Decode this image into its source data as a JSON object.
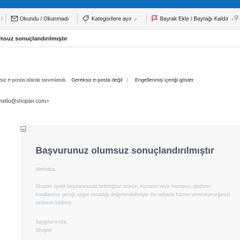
{
  "toolbar": {
    "partial_left": "ıl",
    "read_unread": "Okundu / Okunmadı",
    "categorize": "Kategorilere ayır",
    "flag": "Bayrak Ekle / Bayrağı Kaldır"
  },
  "subject": "msuz sonuçlandırılmıştır",
  "notice": {
    "text": "siz e-posta olarak tanımlandı.",
    "not_junk": "Gereksiz e-posta değil",
    "separator": "|",
    "show_blocked": "Engellenmiş içeriği göster"
  },
  "sender": "hello@shopier.com>",
  "email": {
    "heading": "Başvurunuz olumsuz sonuçlandırılmıştır",
    "greeting": "Merhaba,",
    "paragraph": "Shopier üyelik başvurunuzda belirttiğiniz ürünün, hizmetin veya mecranın, platform kurallarımız gereği uygun olmadığı değerlendirilmiştir. Bu sebeple hizmet veremeyeceğimizi üzülerek bildiririz.",
    "sign_line1": "Saygılarımızla,",
    "sign_line2": "Shopier"
  },
  "colors": {
    "accent_bar": "#0f6cbd",
    "flag": "#c50f1f",
    "heading": "#4a5260",
    "body_text": "#b8c0cc"
  },
  "icons": [
    "envelope-icon",
    "tag-icon",
    "flag-icon",
    "pin-icon",
    "broken-image-icon"
  ]
}
